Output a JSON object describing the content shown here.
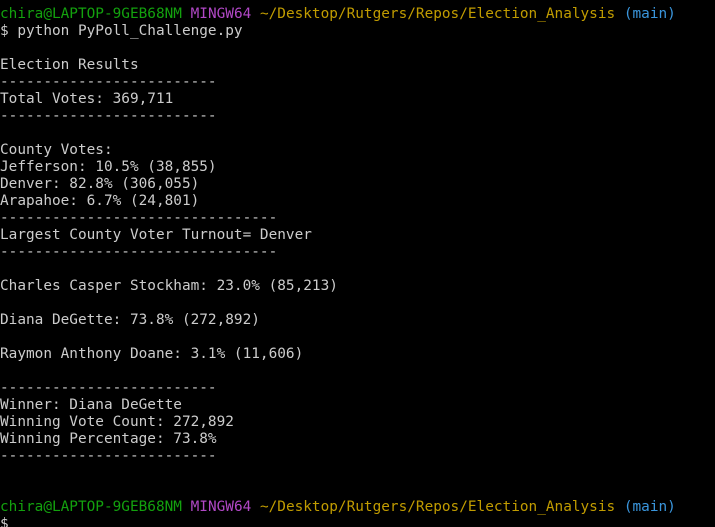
{
  "prompt": {
    "user_host": "chira@LAPTOP-9GEB68NM",
    "shell": "MINGW64",
    "path": "~/Desktop/Rutgers/Repos/Election_Analysis",
    "branch": "(main)",
    "symbol": "$"
  },
  "command": "$ python PyPoll_Challenge.py",
  "output": {
    "title": "Election Results",
    "separator_short": "-------------------------",
    "separator_long": "--------------------------------",
    "total_votes": "Total Votes: 369,711",
    "county_header": "County Votes:",
    "counties": [
      "Jefferson: 10.5% (38,855)",
      "Denver: 82.8% (306,055)",
      "Arapahoe: 6.7% (24,801)"
    ],
    "largest_county": "Largest County Voter Turnout= Denver",
    "candidates": [
      "Charles Casper Stockham: 23.0% (85,213)",
      "Diana DeGette: 73.8% (272,892)",
      "Raymon Anthony Doane: 3.1% (11,606)"
    ],
    "winner": "Winner: Diana DeGette",
    "winning_count": "Winning Vote Count: 272,892",
    "winning_percentage": "Winning Percentage: 73.8%"
  },
  "colors": {
    "background": "#000000",
    "text": "#cccccc",
    "user_host": "#13a10e",
    "shell": "#b148c6",
    "path": "#c19c00",
    "branch": "#3a96dd"
  }
}
